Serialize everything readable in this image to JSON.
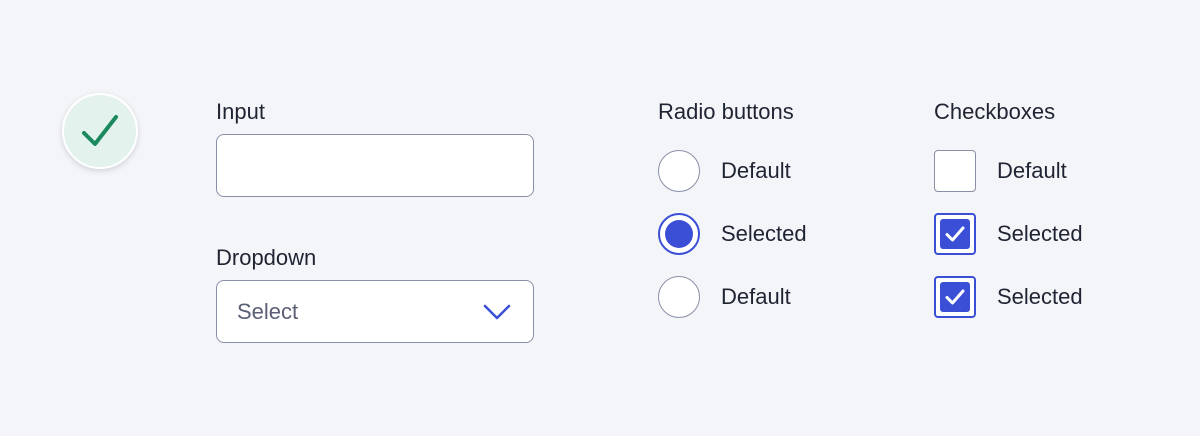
{
  "colors": {
    "background": "#f4f5f9",
    "accent": "#3b4fd6",
    "success": "#1a8a5e",
    "success_bg": "#e4f2ee",
    "border": "#8a8fa8",
    "text": "#1f2433"
  },
  "badge": {
    "icon": "checkmark-icon"
  },
  "input": {
    "label": "Input",
    "value": "",
    "placeholder": ""
  },
  "dropdown": {
    "label": "Dropdown",
    "selected": "Select",
    "icon": "chevron-down-icon"
  },
  "radios": {
    "heading": "Radio buttons",
    "options": [
      {
        "label": "Default",
        "selected": false
      },
      {
        "label": "Selected",
        "selected": true
      },
      {
        "label": "Default",
        "selected": false
      }
    ]
  },
  "checkboxes": {
    "heading": "Checkboxes",
    "options": [
      {
        "label": "Default",
        "checked": false
      },
      {
        "label": "Selected",
        "checked": true
      },
      {
        "label": "Selected",
        "checked": true
      }
    ]
  }
}
